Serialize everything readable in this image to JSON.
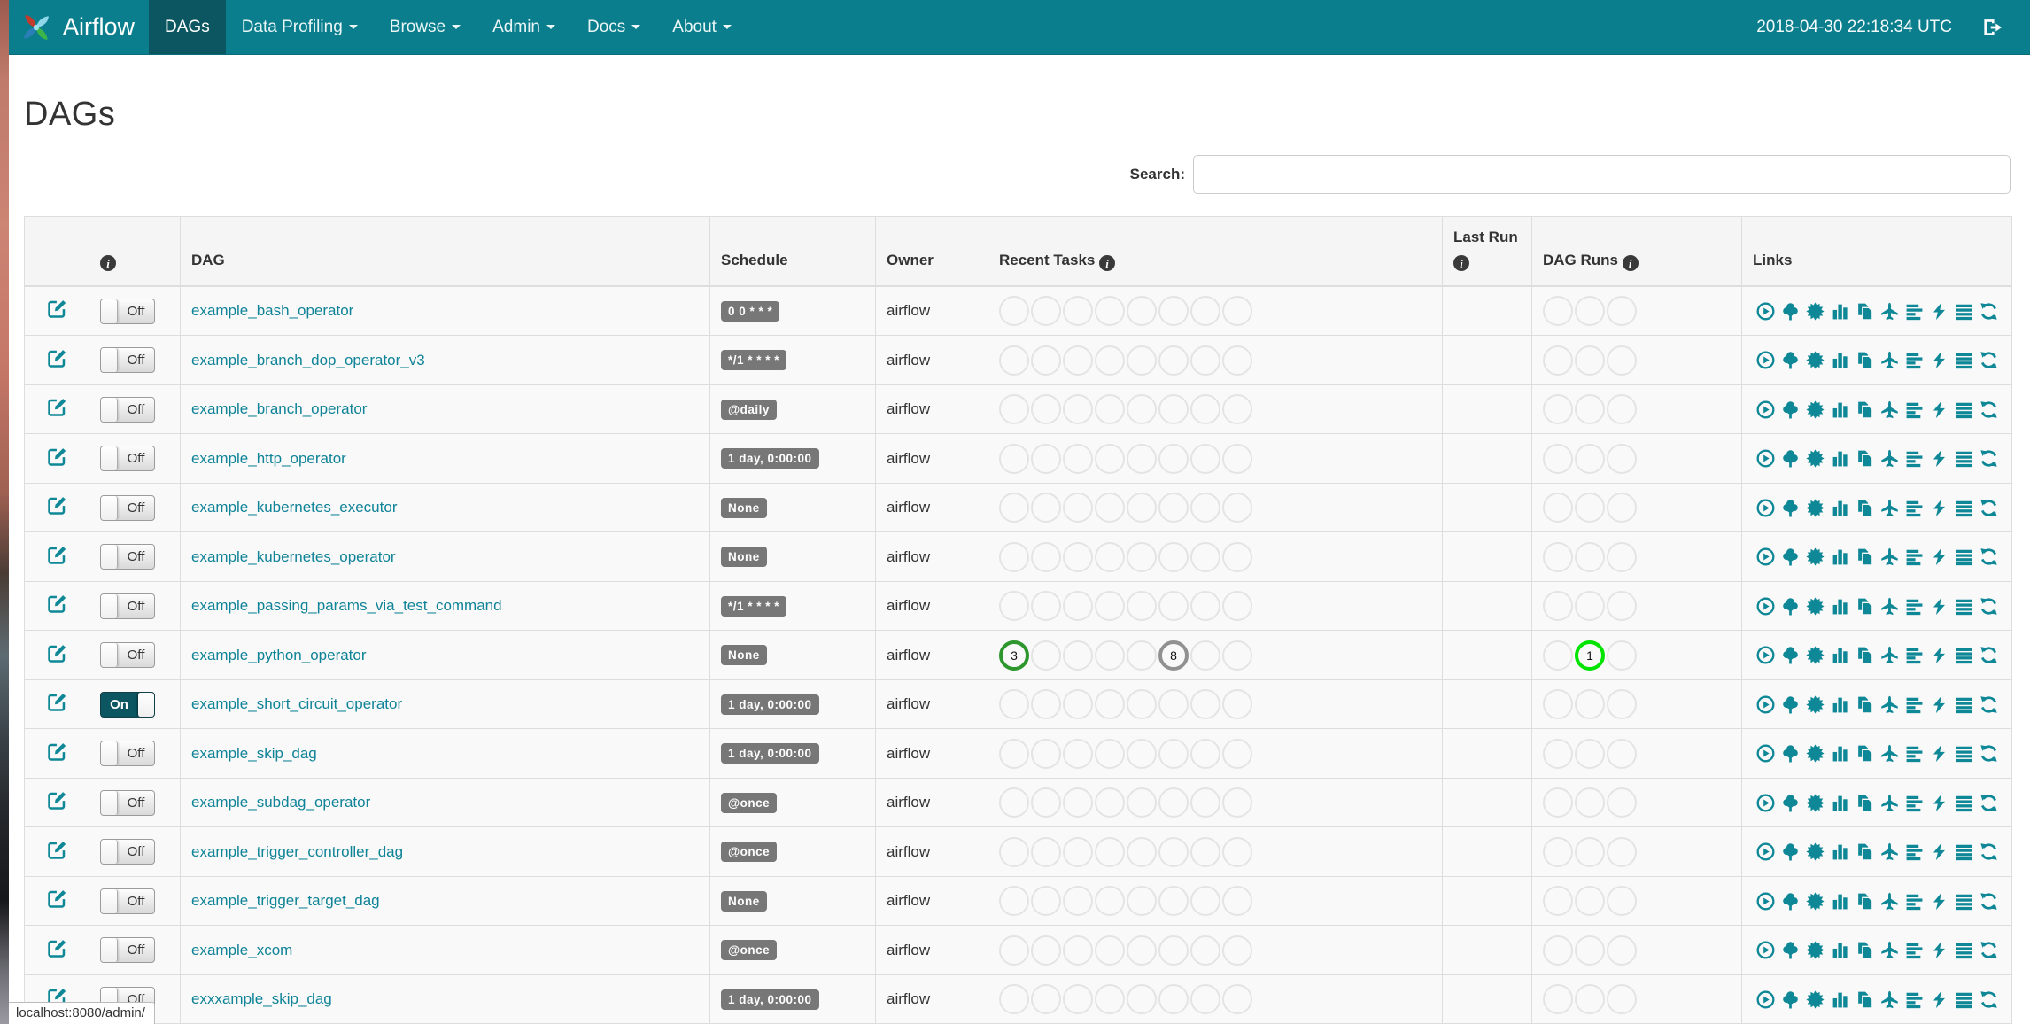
{
  "navbar": {
    "brand": "Airflow",
    "items": [
      {
        "label": "DAGs",
        "active": true,
        "caret": false
      },
      {
        "label": "Data Profiling",
        "active": false,
        "caret": true
      },
      {
        "label": "Browse",
        "active": false,
        "caret": true
      },
      {
        "label": "Admin",
        "active": false,
        "caret": true
      },
      {
        "label": "Docs",
        "active": false,
        "caret": true
      },
      {
        "label": "About",
        "active": false,
        "caret": true
      }
    ],
    "clock": "2018-04-30 22:18:34 UTC"
  },
  "page": {
    "title": "DAGs",
    "search_label": "Search:",
    "search_value": ""
  },
  "colors": {
    "navbar_bg": "#0A7E8D",
    "navbar_active_bg": "#0B5660",
    "link_teal": "#0F8397",
    "icon_teal": "#0E8796",
    "badge_bg": "#777777",
    "success_green": "#2D962D",
    "queued_gray": "#919191",
    "running_lime": "#00E400"
  },
  "table": {
    "headers": {
      "dag": "DAG",
      "schedule": "Schedule",
      "owner": "Owner",
      "recent_tasks": "Recent Tasks",
      "last_run": "Last Run",
      "dag_runs": "DAG Runs",
      "links": "Links"
    },
    "toggle_on_label": "On",
    "toggle_off_label": "Off",
    "recent_tasks_slots": 8,
    "dag_runs_slots": 3,
    "link_icons": [
      "trigger-dag",
      "tree-view",
      "graph-view",
      "task-duration",
      "task-tries",
      "landing-times",
      "gantt",
      "code-view",
      "logs",
      "refresh"
    ],
    "rows": [
      {
        "name": "example_bash_operator",
        "schedule": "0 0 * * *",
        "owner": "airflow",
        "on": false,
        "recent_tasks": null,
        "dag_runs": null
      },
      {
        "name": "example_branch_dop_operator_v3",
        "schedule": "*/1 * * * *",
        "owner": "airflow",
        "on": false,
        "recent_tasks": null,
        "dag_runs": null
      },
      {
        "name": "example_branch_operator",
        "schedule": "@daily",
        "owner": "airflow",
        "on": false,
        "recent_tasks": null,
        "dag_runs": null
      },
      {
        "name": "example_http_operator",
        "schedule": "1 day, 0:00:00",
        "owner": "airflow",
        "on": false,
        "recent_tasks": null,
        "dag_runs": null
      },
      {
        "name": "example_kubernetes_executor",
        "schedule": "None",
        "owner": "airflow",
        "on": false,
        "recent_tasks": null,
        "dag_runs": null
      },
      {
        "name": "example_kubernetes_operator",
        "schedule": "None",
        "owner": "airflow",
        "on": false,
        "recent_tasks": null,
        "dag_runs": null
      },
      {
        "name": "example_passing_params_via_test_command",
        "schedule": "*/1 * * * *",
        "owner": "airflow",
        "on": false,
        "recent_tasks": null,
        "dag_runs": null
      },
      {
        "name": "example_python_operator",
        "schedule": "None",
        "owner": "airflow",
        "on": false,
        "recent_tasks": [
          {
            "count": 3,
            "color_key": "success_green"
          },
          null,
          null,
          null,
          null,
          {
            "count": 8,
            "color_key": "queued_gray"
          },
          null,
          null
        ],
        "dag_runs": [
          null,
          {
            "count": 1,
            "color_key": "running_lime"
          },
          null
        ]
      },
      {
        "name": "example_short_circuit_operator",
        "schedule": "1 day, 0:00:00",
        "owner": "airflow",
        "on": true,
        "recent_tasks": null,
        "dag_runs": null
      },
      {
        "name": "example_skip_dag",
        "schedule": "1 day, 0:00:00",
        "owner": "airflow",
        "on": false,
        "recent_tasks": null,
        "dag_runs": null
      },
      {
        "name": "example_subdag_operator",
        "schedule": "@once",
        "owner": "airflow",
        "on": false,
        "recent_tasks": null,
        "dag_runs": null
      },
      {
        "name": "example_trigger_controller_dag",
        "schedule": "@once",
        "owner": "airflow",
        "on": false,
        "recent_tasks": null,
        "dag_runs": null
      },
      {
        "name": "example_trigger_target_dag",
        "schedule": "None",
        "owner": "airflow",
        "on": false,
        "recent_tasks": null,
        "dag_runs": null
      },
      {
        "name": "example_xcom",
        "schedule": "@once",
        "owner": "airflow",
        "on": false,
        "recent_tasks": null,
        "dag_runs": null
      },
      {
        "name": "exxxample_skip_dag",
        "schedule": "1 day, 0:00:00",
        "owner": "airflow",
        "on": false,
        "recent_tasks": null,
        "dag_runs": null
      }
    ]
  },
  "statusbar": {
    "url": "localhost:8080/admin/"
  }
}
